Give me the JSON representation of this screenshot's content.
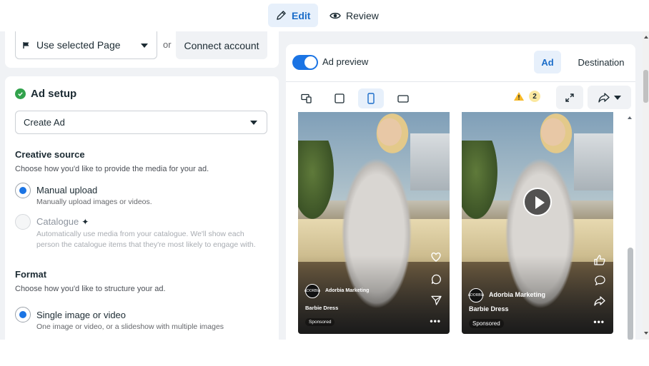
{
  "header": {
    "edit_label": "Edit",
    "review_label": "Review"
  },
  "identity": {
    "page_select_value": "Use selected Page",
    "or_text": "or",
    "connect_label": "Connect account"
  },
  "ad_setup": {
    "title": "Ad setup",
    "select_value": "Create Ad",
    "creative_source": {
      "title": "Creative source",
      "description": "Choose how you'd like to provide the media for your ad.",
      "options": [
        {
          "label": "Manual upload",
          "description": "Manually upload images or videos.",
          "selected": true,
          "disabled": false
        },
        {
          "label": "Catalogue",
          "description": "Automatically use media from your catalogue. We'll show each person the catalogue items that they're most likely to engage with.",
          "selected": false,
          "disabled": true
        }
      ]
    },
    "format": {
      "title": "Format",
      "description": "Choose how you'd like to structure your ad.",
      "options": [
        {
          "label": "Single image or video",
          "description": "One image or video, or a slideshow with multiple images",
          "selected": true
        }
      ]
    }
  },
  "preview": {
    "toggle_label": "Ad preview",
    "toggle_on": true,
    "segments": {
      "ad": "Ad",
      "destination": "Destination"
    },
    "warning_count": "2",
    "cards": [
      {
        "advertiser": "Adorbia Marketing",
        "avatar_text": "ADORBIA",
        "caption": "Barbie Dress",
        "sponsored": "Sponsored",
        "placement": "reels"
      },
      {
        "advertiser": "Adorbia Marketing",
        "avatar_text": "ADORBIA",
        "caption": "Barbie Dress",
        "sponsored": "Sponsored",
        "placement": "facebook-reels"
      }
    ]
  },
  "colors": {
    "accent": "#1b74e4",
    "accent_text": "#1b6dc9",
    "accent_bg": "#e7f0fb",
    "success": "#31a24c",
    "warning": "#f7b928",
    "pane_bg": "#f0f2f5"
  }
}
